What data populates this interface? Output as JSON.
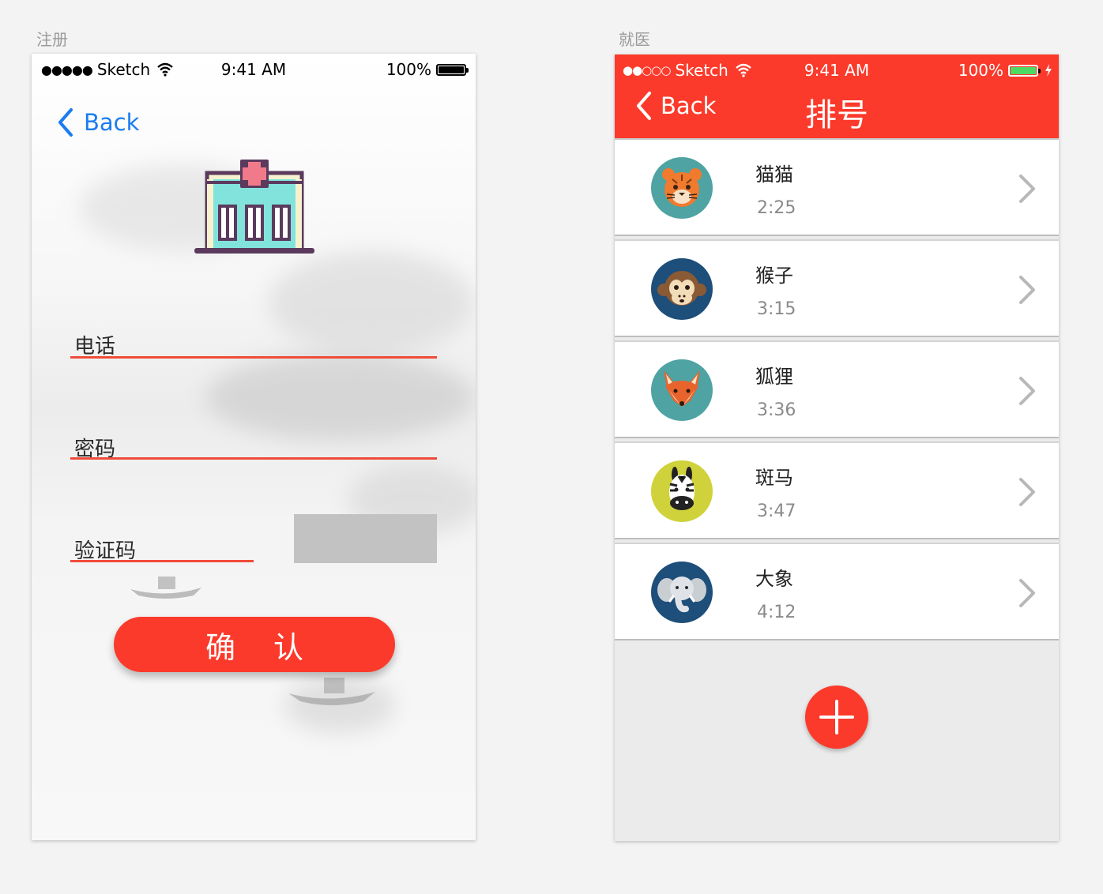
{
  "artboards": {
    "left_label": "注册",
    "right_label": "就医"
  },
  "register": {
    "status": {
      "carrier": "Sketch",
      "time": "9:41 AM",
      "battery": "100%"
    },
    "back_label": "Back",
    "fields": {
      "phone_label": "电话",
      "password_label": "密码",
      "code_label": "验证码"
    },
    "confirm_label": "确 认",
    "colors": {
      "accent": "#fb3a2b",
      "back": "#1a7cf2"
    }
  },
  "queue": {
    "status": {
      "carrier": "Sketch",
      "time": "9:41 AM",
      "battery": "100%"
    },
    "back_label": "Back",
    "title": "排号",
    "items": [
      {
        "name": "猫猫",
        "time": "2:25",
        "icon": "tiger-avatar-icon"
      },
      {
        "name": "猴子",
        "time": "3:15",
        "icon": "monkey-avatar-icon"
      },
      {
        "name": "狐狸",
        "time": "3:36",
        "icon": "fox-avatar-icon"
      },
      {
        "name": "斑马",
        "time": "3:47",
        "icon": "zebra-avatar-icon"
      },
      {
        "name": "大象",
        "time": "4:12",
        "icon": "elephant-avatar-icon"
      }
    ],
    "fab_icon": "plus-icon",
    "colors": {
      "header": "#fb3a2b",
      "list_bg": "#ffffff",
      "page_bg": "#ebebeb"
    }
  }
}
